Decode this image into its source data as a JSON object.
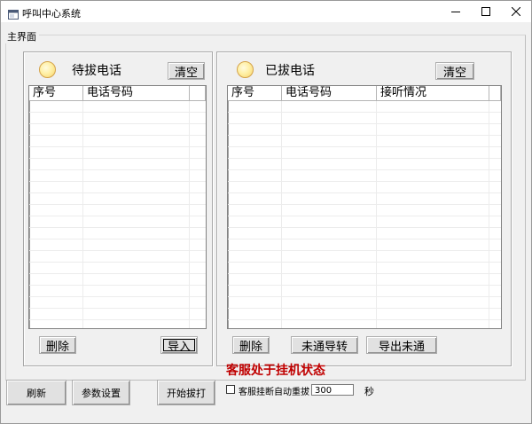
{
  "window": {
    "title": "呼叫中心系统"
  },
  "main_group": {
    "legend": "主界面"
  },
  "pending_panel": {
    "title": "待拔电话",
    "clear_label": "清空",
    "columns": [
      "序号",
      "电话号码",
      ""
    ],
    "rows": [],
    "delete_label": "删除",
    "import_label": "导入"
  },
  "dialed_panel": {
    "title": "已拔电话",
    "clear_label": "清空",
    "columns": [
      "序号",
      "电话号码",
      "接听情况",
      ""
    ],
    "rows": [],
    "delete_label": "删除",
    "redirect_label": "未通导转",
    "export_label": "导出未通"
  },
  "bottom_bar": {
    "refresh_label": "刷新",
    "settings_label": "参数设置",
    "start_label": "开始拔打",
    "status_text": "客服处于挂机状态",
    "auto_redial_label": "客服挂断自动重拔",
    "auto_redial_checked": false,
    "seconds_value": "300",
    "seconds_unit": "秒"
  },
  "colors": {
    "status_text": "#c00000",
    "lamp": "#fff0a6"
  },
  "icons": {
    "app": "app-window-icon",
    "minimize": "minimize-icon",
    "maximize": "maximize-icon",
    "close": "close-icon",
    "lamp": "indicator-lamp"
  }
}
